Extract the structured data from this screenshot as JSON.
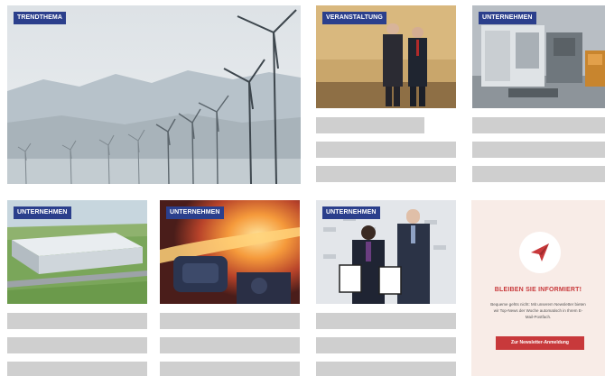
{
  "cards": [
    {
      "id": "trendthema",
      "tag": "TRENDTHEMA",
      "image": "wind-turbines"
    },
    {
      "id": "veranstaltung",
      "tag": "VERANSTALTUNG",
      "image": "award-ceremony"
    },
    {
      "id": "unternehmen-1",
      "tag": "UNTERNEHMEN",
      "image": "industrial-machine"
    },
    {
      "id": "unternehmen-2",
      "tag": "UNTERNEHMEN",
      "image": "factory-aerial"
    },
    {
      "id": "unternehmen-3",
      "tag": "UNTERNEHMEN",
      "image": "molten-metal"
    },
    {
      "id": "unternehmen-4",
      "tag": "UNTERNEHMEN",
      "image": "certificate-handover"
    }
  ],
  "newsletter": {
    "icon": "paper-plane-icon",
    "heading": "BLEIBEN SIE INFORMIERT!",
    "text": "Bequeme gehts nicht: Mit unserem Newsletter bieten wir Top-News der Woche automatisch in Ihrem E-Mail-Postfach.",
    "button": "Zur Newsletter-Anmeldung"
  },
  "colors": {
    "tag_bg": "#2b3f8c",
    "placeholder": "#cfcfcf",
    "newsletter_bg": "#f8ece7",
    "accent": "#c8393b"
  }
}
